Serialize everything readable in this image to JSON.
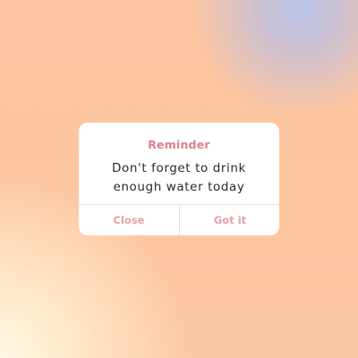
{
  "dialog": {
    "title": "Reminder",
    "message_line1": "Don't forget to drink",
    "message_line2": "enough water today",
    "buttons": {
      "close": "Close",
      "got_it": "Got it"
    }
  },
  "colors": {
    "accent": "#df7f8e",
    "button_text": "#e3a0a9",
    "background": "#fcc7a3",
    "dialog_bg": "#ffffff"
  }
}
